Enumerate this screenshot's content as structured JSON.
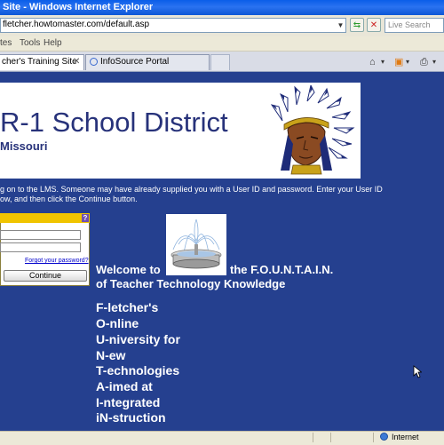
{
  "browser": {
    "window_title": "Site - Windows Internet Explorer",
    "address": "fletcher.howtomaster.com/default.asp",
    "search_placeholder": "Live Search",
    "menu": [
      "tes",
      "Tools",
      "Help"
    ],
    "tabs": [
      {
        "label": "cher's Training Site",
        "active": true
      },
      {
        "label": "InfoSource Portal",
        "active": false
      }
    ],
    "status_zone": "Internet"
  },
  "page": {
    "banner_title": "R-1 School District",
    "banner_subtitle": "Missouri",
    "intro_line1": "g on to the LMS. Someone may have already supplied you with a User ID and password. Enter your User ID",
    "intro_line2": "ow, and then click the Continue button.",
    "login": {
      "help_label": "?",
      "forgot_link": "Forgot your password?",
      "continue_label": "Continue"
    },
    "welcome_prefix": "Welcome to",
    "welcome_suffix": "the F.O.U.N.T.A.I.N.",
    "welcome_line2": "of Teacher Technology Knowledge",
    "acronym": [
      "F-letcher's",
      "O-nline",
      "U-niversity for",
      "N-ew",
      "T-echnologies",
      "A-imed at",
      "I-ntegrated",
      "iN-struction"
    ]
  },
  "colors": {
    "page_background": "#25408f",
    "banner_text": "#27327a",
    "login_header": "#f0c400",
    "titlebar": "#0a5ee8"
  }
}
